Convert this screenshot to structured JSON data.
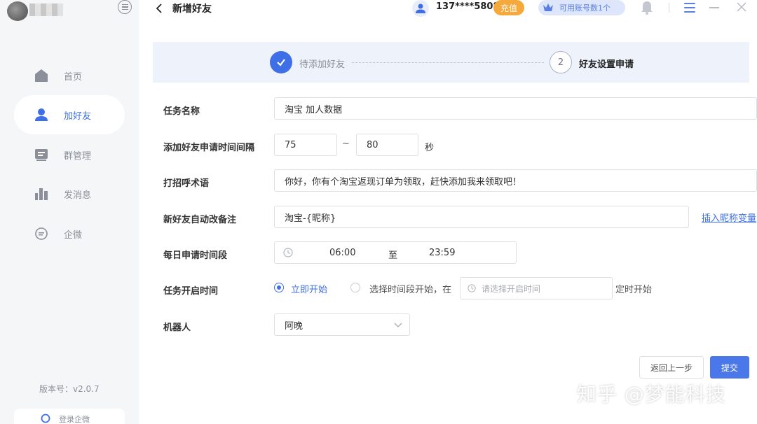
{
  "sidebar": {
    "nav": [
      {
        "label": "首页",
        "icon": "home-icon"
      },
      {
        "label": "加好友",
        "icon": "user-icon"
      },
      {
        "label": "群管理",
        "icon": "group-manage-icon"
      },
      {
        "label": "发消息",
        "icon": "bar-chart-icon"
      },
      {
        "label": "企微",
        "icon": "chat-icon"
      }
    ],
    "active_index": 1,
    "version": "版本号：v2.0.7",
    "login_text": "登录企微"
  },
  "header": {
    "title": "新增好友",
    "phone": "137****5808",
    "recharge_label": "充值",
    "accounts_label": "可用账号数1个"
  },
  "steps": {
    "step1_label": "待添加好友",
    "step2_number": "2",
    "step2_label": "好友设置申请"
  },
  "form": {
    "task_name_label": "任务名称",
    "task_name_value": "淘宝 加人数据",
    "interval_label": "添加好友申请时间间隔",
    "interval_min": "75",
    "interval_sep": "~",
    "interval_max": "80",
    "interval_unit": "秒",
    "greeting_label": "打招呼术语",
    "greeting_value": "你好，你有个淘宝返现订单为领取，赶快添加我来领取吧！",
    "remark_label": "新好友自动改备注",
    "remark_value": "淘宝-{昵称}",
    "insert_var_link": "插入昵称变量",
    "daily_period_label": "每日申请时间段",
    "daily_start": "06:00",
    "daily_to": "至",
    "daily_end": "23:59",
    "start_time_label": "任务开启时间",
    "option_now": "立即开始",
    "option_scheduled": "选择时间段开始，在",
    "start_time_placeholder": "请选择开启时间",
    "timed_start": "定时开始",
    "robot_label": "机器人",
    "robot_value": "阿晚"
  },
  "actions": {
    "back_label": "返回上一步",
    "submit_label": "提交"
  },
  "watermark": "知乎 @梦能科技",
  "colors": {
    "accent": "#3f6fe6",
    "recharge": "#f6a93b",
    "sidebar_bg": "#f5f6f8",
    "steps_bg": "#eef2fb"
  }
}
